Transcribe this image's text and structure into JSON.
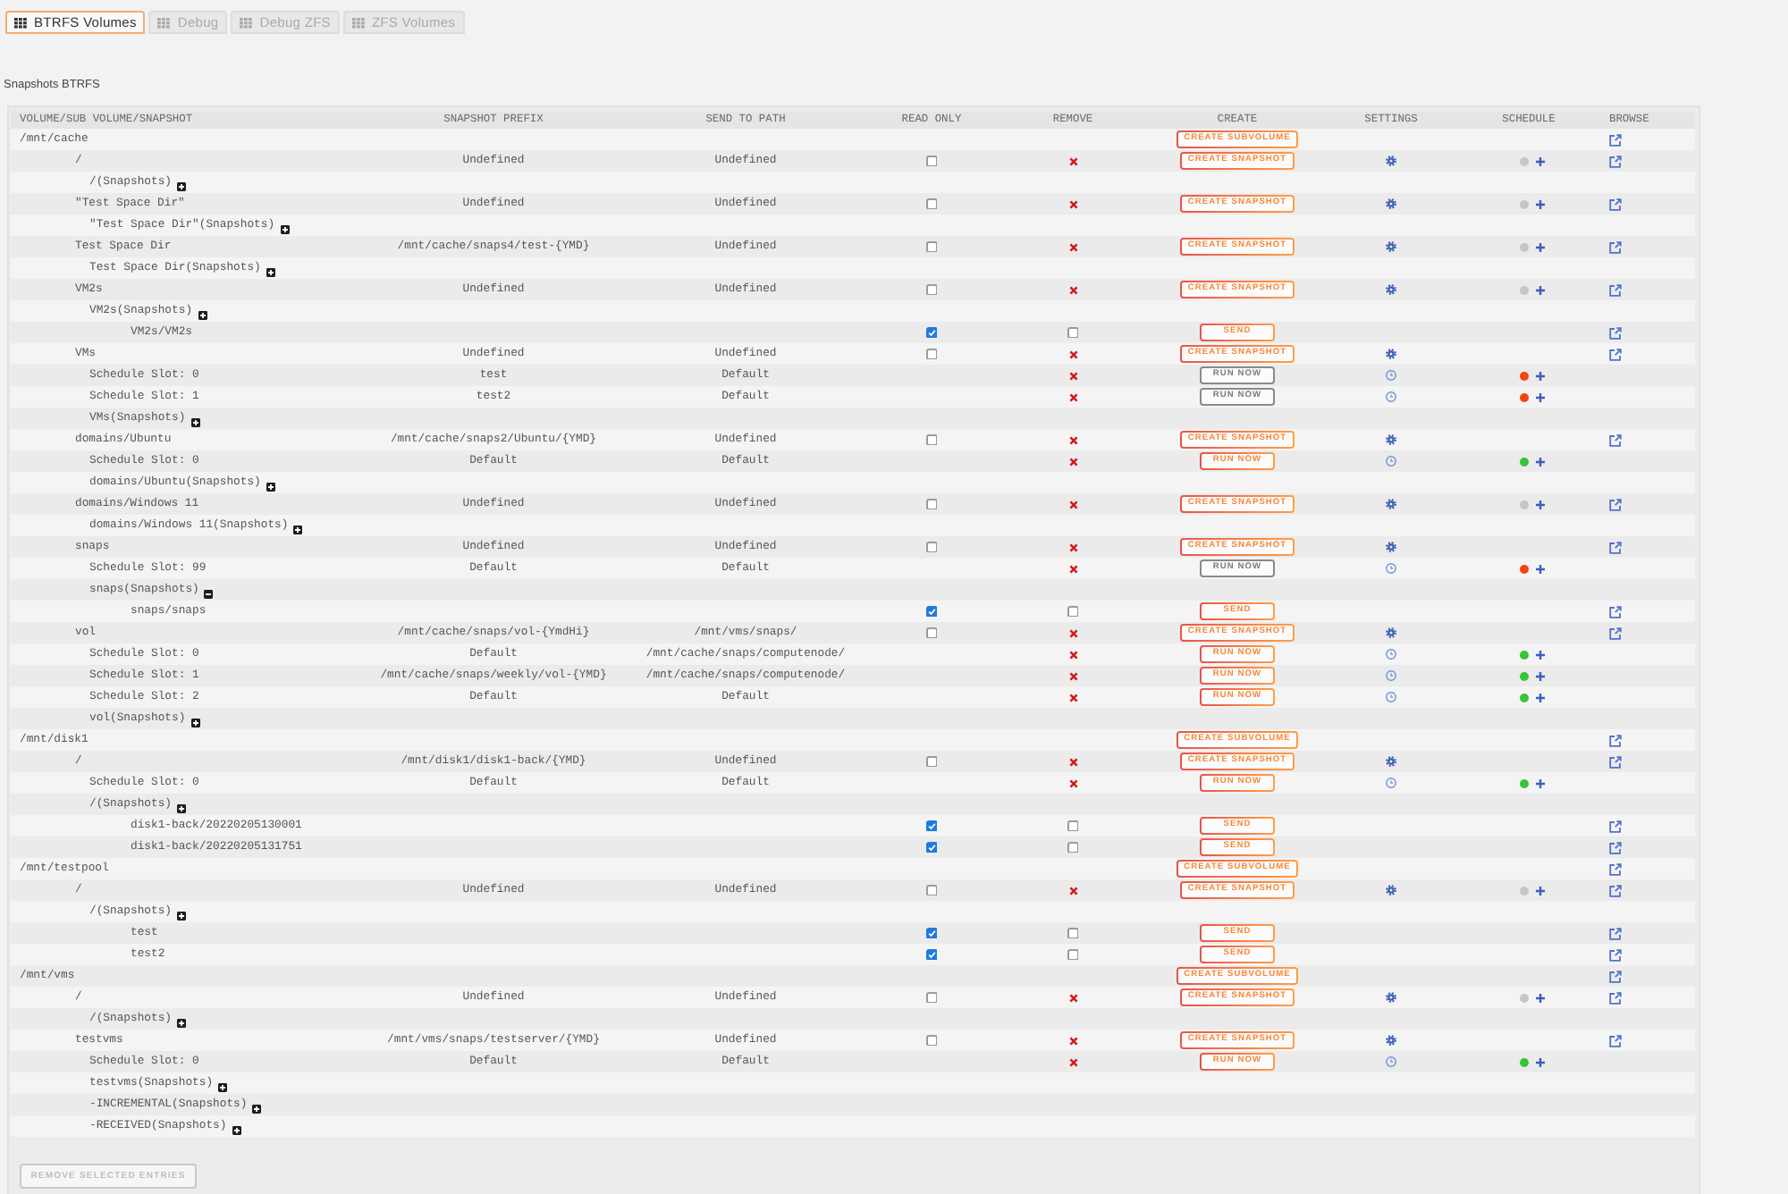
{
  "tabs": [
    {
      "label": "BTRFS Volumes",
      "selected": true
    },
    {
      "label": "Debug",
      "selected": false
    },
    {
      "label": "Debug ZFS",
      "selected": false
    },
    {
      "label": "ZFS Volumes",
      "selected": false
    }
  ],
  "section_title": "Snapshots BTRFS",
  "table": {
    "columns": [
      "VOLUME/SUB VOLUME/SNAPSHOT",
      "SNAPSHOT PREFIX",
      "SEND TO PATH",
      "READ ONLY",
      "REMOVE",
      "CREATE",
      "SETTINGS",
      "SCHEDULE",
      "BROWSE"
    ],
    "rows": [
      {
        "kind": "pool",
        "name": "/mnt/cache",
        "action": "CREATE SUBVOLUME",
        "children": [
          {
            "kind": "subvolume",
            "name": "/",
            "prefix": "Undefined",
            "send_to": "Undefined",
            "read_only": false,
            "action": "CREATE SNAPSHOT",
            "color": "#c6c6c6",
            "children": [
              {
                "kind": "group",
                "name": "/(Snapshots)",
                "expanded": false
              }
            ]
          },
          {
            "kind": "subvolume",
            "name": "\"Test Space Dir\"",
            "prefix": "Undefined",
            "send_to": "Undefined",
            "read_only": false,
            "action": "CREATE SNAPSHOT",
            "color": "#c6c6c6",
            "children": [
              {
                "kind": "group",
                "name": "\"Test Space Dir\"(Snapshots)",
                "expanded": false
              }
            ]
          },
          {
            "kind": "subvolume",
            "name": "Test Space Dir",
            "prefix": "/mnt/cache/snaps4/test-{YMD}",
            "send_to": "Undefined",
            "read_only": false,
            "action": "CREATE SNAPSHOT",
            "color": "#c6c6c6",
            "children": [
              {
                "kind": "group",
                "name": "Test Space Dir(Snapshots)",
                "expanded": false
              }
            ]
          },
          {
            "kind": "subvolume",
            "name": "VM2s",
            "prefix": "Undefined",
            "send_to": "Undefined",
            "read_only": false,
            "action": "CREATE SNAPSHOT",
            "color": "#c6c6c6",
            "children": [
              {
                "kind": "group",
                "name": "VM2s(Snapshots)",
                "expanded": false,
                "children": [
                  {
                    "kind": "snapshot",
                    "name": "VM2s/VM2s",
                    "read_only": true,
                    "remove_checked": false,
                    "action": "SEND"
                  }
                ]
              }
            ]
          },
          {
            "kind": "subvolume",
            "name": "VMs",
            "prefix": "Undefined",
            "send_to": "Undefined",
            "read_only": false,
            "action": "CREATE SNAPSHOT",
            "children": [
              {
                "kind": "slot",
                "name": "Schedule Slot: 0",
                "prefix": "test",
                "send_to": "Default",
                "action": "RUN NOW",
                "disabled": true,
                "color": "#f2440f"
              },
              {
                "kind": "slot",
                "name": "Schedule Slot: 1",
                "prefix": "test2",
                "send_to": "Default",
                "action": "RUN NOW",
                "disabled": true,
                "color": "#f2440f"
              },
              {
                "kind": "group",
                "name": "VMs(Snapshots)",
                "expanded": false
              }
            ]
          },
          {
            "kind": "subvolume",
            "name": "domains/Ubuntu",
            "prefix": "/mnt/cache/snaps2/Ubuntu/{YMD}",
            "send_to": "Undefined",
            "read_only": false,
            "action": "CREATE SNAPSHOT",
            "children": [
              {
                "kind": "slot",
                "name": "Schedule Slot: 0",
                "prefix": "Default",
                "send_to": "Default",
                "action": "RUN NOW",
                "disabled": false,
                "color": "#35c535"
              },
              {
                "kind": "group",
                "name": "domains/Ubuntu(Snapshots)",
                "expanded": false
              }
            ]
          },
          {
            "kind": "subvolume",
            "name": "domains/Windows 11",
            "prefix": "Undefined",
            "send_to": "Undefined",
            "read_only": false,
            "action": "CREATE SNAPSHOT",
            "color": "#c6c6c6",
            "children": [
              {
                "kind": "group",
                "name": "domains/Windows 11(Snapshots)",
                "expanded": false
              }
            ]
          },
          {
            "kind": "subvolume",
            "name": "snaps",
            "prefix": "Undefined",
            "send_to": "Undefined",
            "read_only": false,
            "action": "CREATE SNAPSHOT",
            "children": [
              {
                "kind": "slot",
                "name": "Schedule Slot: 99",
                "prefix": "Default",
                "send_to": "Default",
                "action": "RUN NOW",
                "disabled": true,
                "color": "#f2440f"
              },
              {
                "kind": "group",
                "name": "snaps(Snapshots)",
                "expanded": true,
                "children": [
                  {
                    "kind": "snapshot",
                    "name": "snaps/snaps",
                    "read_only": true,
                    "remove_checked": false,
                    "action": "SEND"
                  }
                ]
              }
            ]
          },
          {
            "kind": "subvolume",
            "name": "vol",
            "prefix": "/mnt/cache/snaps/vol-{YmdHi}",
            "send_to": "/mnt/vms/snaps/",
            "read_only": false,
            "action": "CREATE SNAPSHOT",
            "children": [
              {
                "kind": "slot",
                "name": "Schedule Slot: 0",
                "prefix": "Default",
                "send_to": "/mnt/cache/snaps/computenode/",
                "action": "RUN NOW",
                "disabled": false,
                "color": "#35c535"
              },
              {
                "kind": "slot",
                "name": "Schedule Slot: 1",
                "prefix": "/mnt/cache/snaps/weekly/vol-{YMD}",
                "send_to": "/mnt/cache/snaps/computenode/",
                "action": "RUN NOW",
                "disabled": false,
                "color": "#35c535"
              },
              {
                "kind": "slot",
                "name": "Schedule Slot: 2",
                "prefix": "Default",
                "send_to": "Default",
                "action": "RUN NOW",
                "disabled": false,
                "color": "#35c535"
              },
              {
                "kind": "group",
                "name": "vol(Snapshots)",
                "expanded": false
              }
            ]
          }
        ]
      },
      {
        "kind": "pool",
        "name": "/mnt/disk1",
        "action": "CREATE SUBVOLUME",
        "children": [
          {
            "kind": "subvolume",
            "name": "/",
            "prefix": "/mnt/disk1/disk1-back/{YMD}",
            "send_to": "Undefined",
            "read_only": false,
            "action": "CREATE SNAPSHOT",
            "children": [
              {
                "kind": "slot",
                "name": "Schedule Slot: 0",
                "prefix": "Default",
                "send_to": "Default",
                "action": "RUN NOW",
                "disabled": false,
                "color": "#35c535"
              },
              {
                "kind": "group",
                "name": "/(Snapshots)",
                "expanded": false,
                "children": [
                  {
                    "kind": "snapshot",
                    "name": "disk1-back/20220205130001",
                    "read_only": true,
                    "remove_checked": false,
                    "action": "SEND"
                  },
                  {
                    "kind": "snapshot",
                    "name": "disk1-back/20220205131751",
                    "read_only": true,
                    "remove_checked": false,
                    "action": "SEND"
                  }
                ]
              }
            ]
          }
        ]
      },
      {
        "kind": "pool",
        "name": "/mnt/testpool",
        "action": "CREATE SUBVOLUME",
        "children": [
          {
            "kind": "subvolume",
            "name": "/",
            "prefix": "Undefined",
            "send_to": "Undefined",
            "read_only": false,
            "action": "CREATE SNAPSHOT",
            "color": "#c6c6c6",
            "children": [
              {
                "kind": "group",
                "name": "/(Snapshots)",
                "expanded": false,
                "children": [
                  {
                    "kind": "snapshot",
                    "name": "test",
                    "read_only": true,
                    "remove_checked": false,
                    "action": "SEND"
                  },
                  {
                    "kind": "snapshot",
                    "name": "test2",
                    "read_only": true,
                    "remove_checked": false,
                    "action": "SEND"
                  }
                ]
              }
            ]
          }
        ]
      },
      {
        "kind": "pool",
        "name": "/mnt/vms",
        "action": "CREATE SUBVOLUME",
        "children": [
          {
            "kind": "subvolume",
            "name": "/",
            "prefix": "Undefined",
            "send_to": "Undefined",
            "read_only": false,
            "action": "CREATE SNAPSHOT",
            "color": "#c6c6c6",
            "children": [
              {
                "kind": "group",
                "name": "/(Snapshots)",
                "expanded": false
              }
            ]
          },
          {
            "kind": "subvolume",
            "name": "testvms",
            "prefix": "/mnt/vms/snaps/testserver/{YMD}",
            "send_to": "Undefined",
            "read_only": false,
            "action": "CREATE SNAPSHOT",
            "children": [
              {
                "kind": "slot",
                "name": "Schedule Slot: 0",
                "prefix": "Default",
                "send_to": "Default",
                "action": "RUN NOW",
                "disabled": false,
                "color": "#35c535"
              },
              {
                "kind": "group",
                "name": "testvms(Snapshots)",
                "expanded": false
              },
              {
                "kind": "group",
                "name": "-INCREMENTAL(Snapshots)",
                "expanded": false
              },
              {
                "kind": "group",
                "name": "-RECEIVED(Snapshots)",
                "expanded": false
              }
            ]
          }
        ]
      }
    ]
  },
  "remove_button": {
    "label": "REMOVE SELECTED ENTRIES",
    "disabled": true
  }
}
